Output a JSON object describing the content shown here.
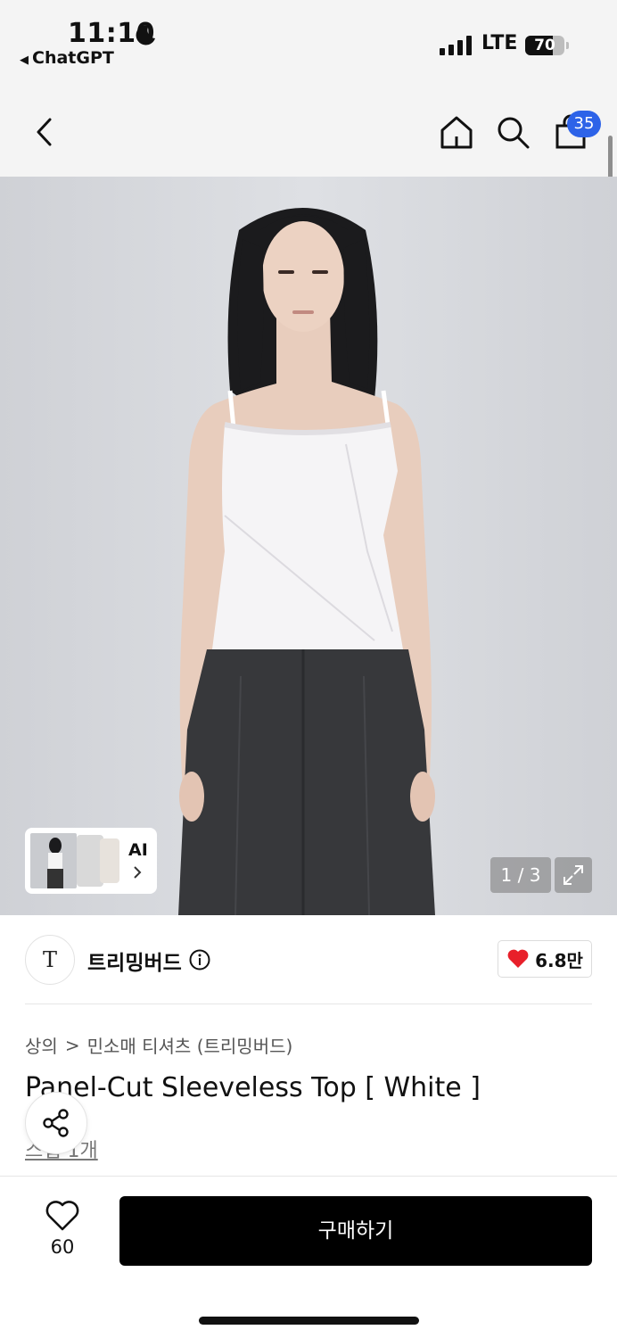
{
  "status_bar": {
    "time": "11:10",
    "back_app": "ChatGPT",
    "network": "LTE",
    "battery": "70",
    "battery_level": 0.7,
    "signal_bars": 4
  },
  "nav": {
    "cart_count": "35"
  },
  "gallery": {
    "pager": "1 / 3",
    "ai_label": "AI"
  },
  "brand": {
    "logo_text": "T",
    "name": "트리밍버드",
    "likes": "6.8만"
  },
  "breadcrumb": {
    "category": "상의",
    "separator": ">",
    "subcategory": "민소매 티셔츠 (트리밍버드)"
  },
  "product": {
    "title": "Panel-Cut Sleeveless Top [ White ]",
    "sub_link": "스냅 1개"
  },
  "bottom": {
    "wish_count": "60",
    "buy_label": "구매하기"
  },
  "colors": {
    "badge_blue": "#2d63e8",
    "heart_red": "#e8202a",
    "buy_black": "#000000"
  }
}
